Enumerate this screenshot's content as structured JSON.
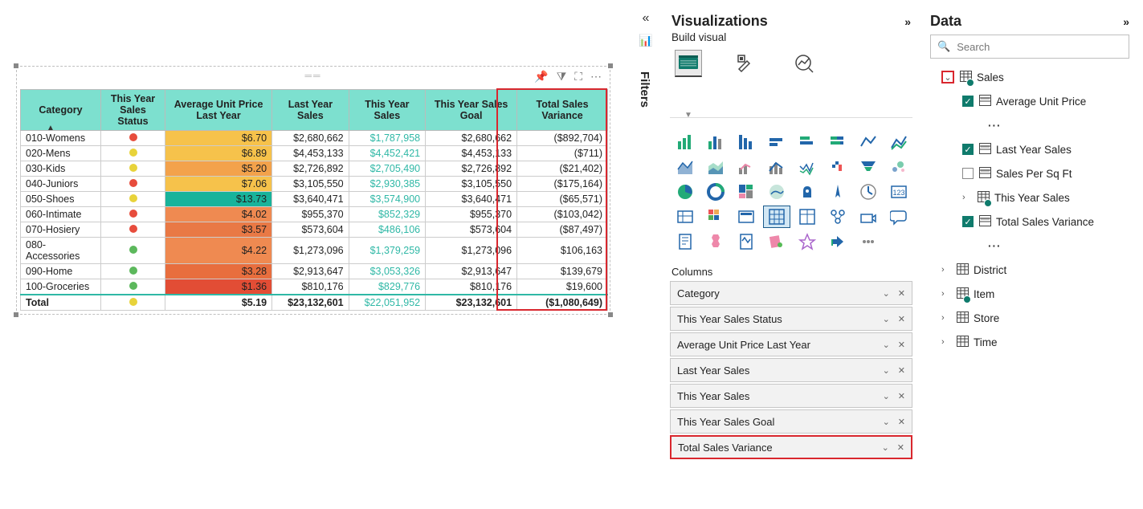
{
  "panes": {
    "filters_label": "Filters",
    "visualizations_title": "Visualizations",
    "build_visual_label": "Build visual",
    "columns_label": "Columns",
    "data_title": "Data",
    "search_placeholder": "Search"
  },
  "table": {
    "headers": [
      "Category",
      "This Year Sales Status",
      "Average Unit Price Last Year",
      "Last Year Sales",
      "This Year Sales",
      "This Year Sales Goal",
      "Total Sales Variance"
    ],
    "rows": [
      {
        "cat": "010-Womens",
        "status": "red",
        "aup": "$6.70",
        "aup_bg": "#f6c24b",
        "lys": "$2,680,662",
        "tys": "$1,787,958",
        "goal": "$2,680,662",
        "var": "($892,704)"
      },
      {
        "cat": "020-Mens",
        "status": "yellow",
        "aup": "$6.89",
        "aup_bg": "#f6c24b",
        "lys": "$4,453,133",
        "tys": "$4,452,421",
        "goal": "$4,453,133",
        "var": "($711)"
      },
      {
        "cat": "030-Kids",
        "status": "yellow",
        "aup": "$5.20",
        "aup_bg": "#f3a24b",
        "lys": "$2,726,892",
        "tys": "$2,705,490",
        "goal": "$2,726,892",
        "var": "($21,402)"
      },
      {
        "cat": "040-Juniors",
        "status": "red",
        "aup": "$7.06",
        "aup_bg": "#f6c24b",
        "lys": "$3,105,550",
        "tys": "$2,930,385",
        "goal": "$3,105,550",
        "var": "($175,164)"
      },
      {
        "cat": "050-Shoes",
        "status": "yellow",
        "aup": "$13.73",
        "aup_bg": "#18b39b",
        "lys": "$3,640,471",
        "tys": "$3,574,900",
        "goal": "$3,640,471",
        "var": "($65,571)"
      },
      {
        "cat": "060-Intimate",
        "status": "red",
        "aup": "$4.02",
        "aup_bg": "#ef8a51",
        "lys": "$955,370",
        "tys": "$852,329",
        "goal": "$955,370",
        "var": "($103,042)"
      },
      {
        "cat": "070-Hosiery",
        "status": "red",
        "aup": "$3.57",
        "aup_bg": "#e97945",
        "lys": "$573,604",
        "tys": "$486,106",
        "goal": "$573,604",
        "var": "($87,497)"
      },
      {
        "cat": "080-Accessories",
        "status": "green",
        "aup": "$4.22",
        "aup_bg": "#ef8a51",
        "lys": "$1,273,096",
        "tys": "$1,379,259",
        "goal": "$1,273,096",
        "var": "$106,163"
      },
      {
        "cat": "090-Home",
        "status": "green",
        "aup": "$3.28",
        "aup_bg": "#e86e3e",
        "lys": "$2,913,647",
        "tys": "$3,053,326",
        "goal": "$2,913,647",
        "var": "$139,679"
      },
      {
        "cat": "100-Groceries",
        "status": "green",
        "aup": "$1.36",
        "aup_bg": "#e24d35",
        "lys": "$810,176",
        "tys": "$829,776",
        "goal": "$810,176",
        "var": "$19,600"
      }
    ],
    "total": {
      "cat": "Total",
      "status": "yellow",
      "aup": "$5.19",
      "lys": "$23,132,601",
      "tys": "$22,051,952",
      "goal": "$23,132,601",
      "var": "($1,080,649)"
    }
  },
  "wells": [
    {
      "label": "Category"
    },
    {
      "label": "This Year Sales Status"
    },
    {
      "label": "Average Unit Price Last Year"
    },
    {
      "label": "Last Year Sales"
    },
    {
      "label": "This Year Sales"
    },
    {
      "label": "This Year Sales Goal"
    },
    {
      "label": "Total Sales Variance",
      "highlight": true
    }
  ],
  "data_tree": {
    "sales": {
      "label": "Sales",
      "fields": [
        {
          "label": "Average Unit Price",
          "checked": true,
          "ellipsis": true
        },
        {
          "label": "Last Year Sales",
          "checked": true
        },
        {
          "label": "Sales Per Sq Ft",
          "checked": false
        },
        {
          "label": "This Year Sales",
          "checked": null,
          "chev": true,
          "tableicon": true
        },
        {
          "label": "Total Sales Variance",
          "checked": true,
          "highlight": true,
          "ellipsis": true
        }
      ]
    },
    "others": [
      {
        "label": "District"
      },
      {
        "label": "Item",
        "badge": true
      },
      {
        "label": "Store"
      },
      {
        "label": "Time"
      }
    ]
  },
  "chart_data": {
    "type": "table",
    "title": "",
    "columns": [
      "Category",
      "This Year Sales Status",
      "Average Unit Price Last Year",
      "Last Year Sales",
      "This Year Sales",
      "This Year Sales Goal",
      "Total Sales Variance"
    ],
    "data": [
      [
        "010-Womens",
        "red",
        6.7,
        2680662,
        1787958,
        2680662,
        -892704
      ],
      [
        "020-Mens",
        "yellow",
        6.89,
        4453133,
        4452421,
        4453133,
        -711
      ],
      [
        "030-Kids",
        "yellow",
        5.2,
        2726892,
        2705490,
        2726892,
        -21402
      ],
      [
        "040-Juniors",
        "red",
        7.06,
        3105550,
        2930385,
        3105550,
        -175164
      ],
      [
        "050-Shoes",
        "yellow",
        13.73,
        3640471,
        3574900,
        3640471,
        -65571
      ],
      [
        "060-Intimate",
        "red",
        4.02,
        955370,
        852329,
        955370,
        -103042
      ],
      [
        "070-Hosiery",
        "red",
        3.57,
        573604,
        486106,
        573604,
        -87497
      ],
      [
        "080-Accessories",
        "green",
        4.22,
        1273096,
        1379259,
        1273096,
        106163
      ],
      [
        "090-Home",
        "green",
        3.28,
        2913647,
        3053326,
        2913647,
        139679
      ],
      [
        "100-Groceries",
        "green",
        1.36,
        810176,
        829776,
        810176,
        19600
      ]
    ],
    "totals": [
      "Total",
      "yellow",
      5.19,
      23132601,
      22051952,
      23132601,
      -1080649
    ]
  }
}
